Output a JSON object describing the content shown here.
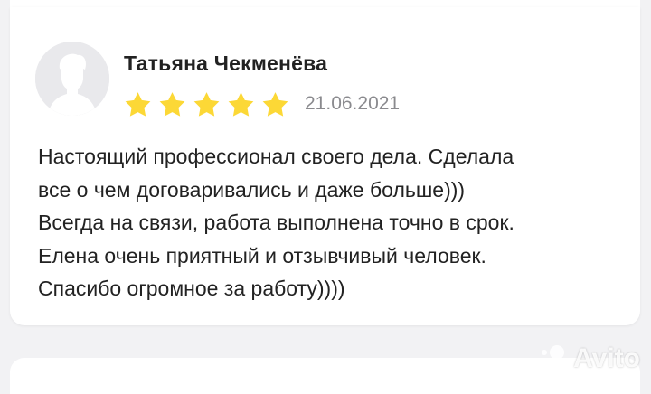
{
  "review": {
    "author": "Татьяна Чекменёва",
    "rating": 5,
    "rating_max": 5,
    "date": "21.06.2021",
    "lines": [
      "Настоящий профессионал своего дела. Сделала",
      "все о чем договаривались и даже больше)))",
      "Всегда на связи, работа выполнена точно в срок.",
      "Елена очень приятный и отзывчивый человек.",
      "Спасибо огромное за работу))))"
    ]
  },
  "colors": {
    "star": "#fcd836",
    "author": "#222222",
    "date": "#8a8a8e",
    "background": "#f2f2f4",
    "card": "#ffffff"
  },
  "icons": [
    "avatar-placeholder-icon",
    "star-icon",
    "avito-logo-icon"
  ],
  "watermark": {
    "brand": "Avito"
  }
}
